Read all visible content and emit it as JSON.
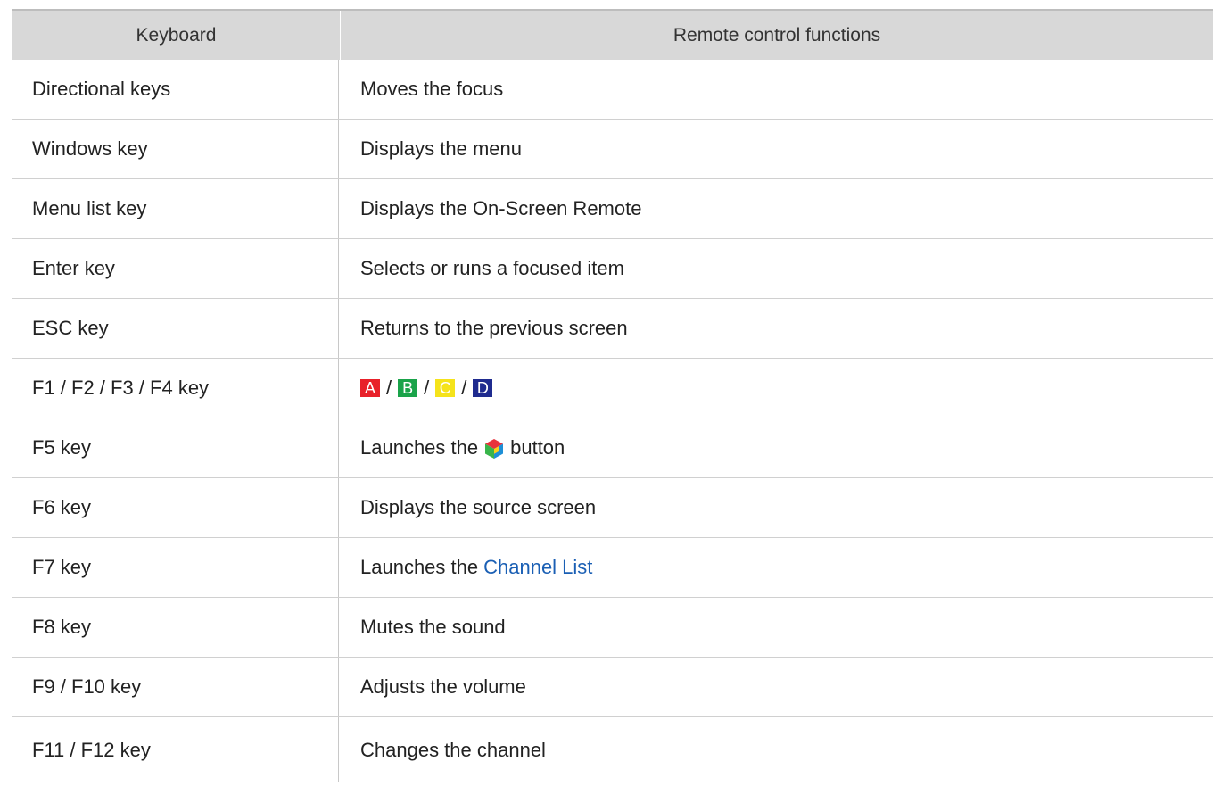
{
  "table": {
    "headers": {
      "keyboard": "Keyboard",
      "remote": "Remote control functions"
    },
    "rows": [
      {
        "key": "Directional keys",
        "function": "Moves the focus"
      },
      {
        "key": "Windows key",
        "function": "Displays the menu"
      },
      {
        "key": "Menu list key",
        "function": "Displays the On-Screen Remote"
      },
      {
        "key": "Enter key",
        "function": "Selects or runs a focused item"
      },
      {
        "key": "ESC key",
        "function": "Returns to the previous screen"
      },
      {
        "key": "F1 / F2 / F3 / F4 key",
        "color_buttons": [
          {
            "label": "A",
            "color": "#e8212a"
          },
          {
            "label": "B",
            "color": "#1aa34a"
          },
          {
            "label": "C",
            "color": "#f5e31b"
          },
          {
            "label": "D",
            "color": "#1f2b8f"
          }
        ],
        "separator": "/"
      },
      {
        "key": "F5 key",
        "function_pre": "Launches the",
        "icon": "smart-hub-icon",
        "function_post": "button"
      },
      {
        "key": "F6 key",
        "function": "Displays the source screen"
      },
      {
        "key": "F7 key",
        "function_pre": "Launches the",
        "link": "Channel List"
      },
      {
        "key": "F8 key",
        "function": "Mutes the sound"
      },
      {
        "key": "F9 / F10 key",
        "function": "Adjusts the volume"
      },
      {
        "key": "F11 / F12 key",
        "function": "Changes the channel"
      }
    ]
  },
  "colors": {
    "link": "#1a5fb4",
    "header_bg": "#d8d8d8",
    "divider": "#d0d0d0"
  }
}
